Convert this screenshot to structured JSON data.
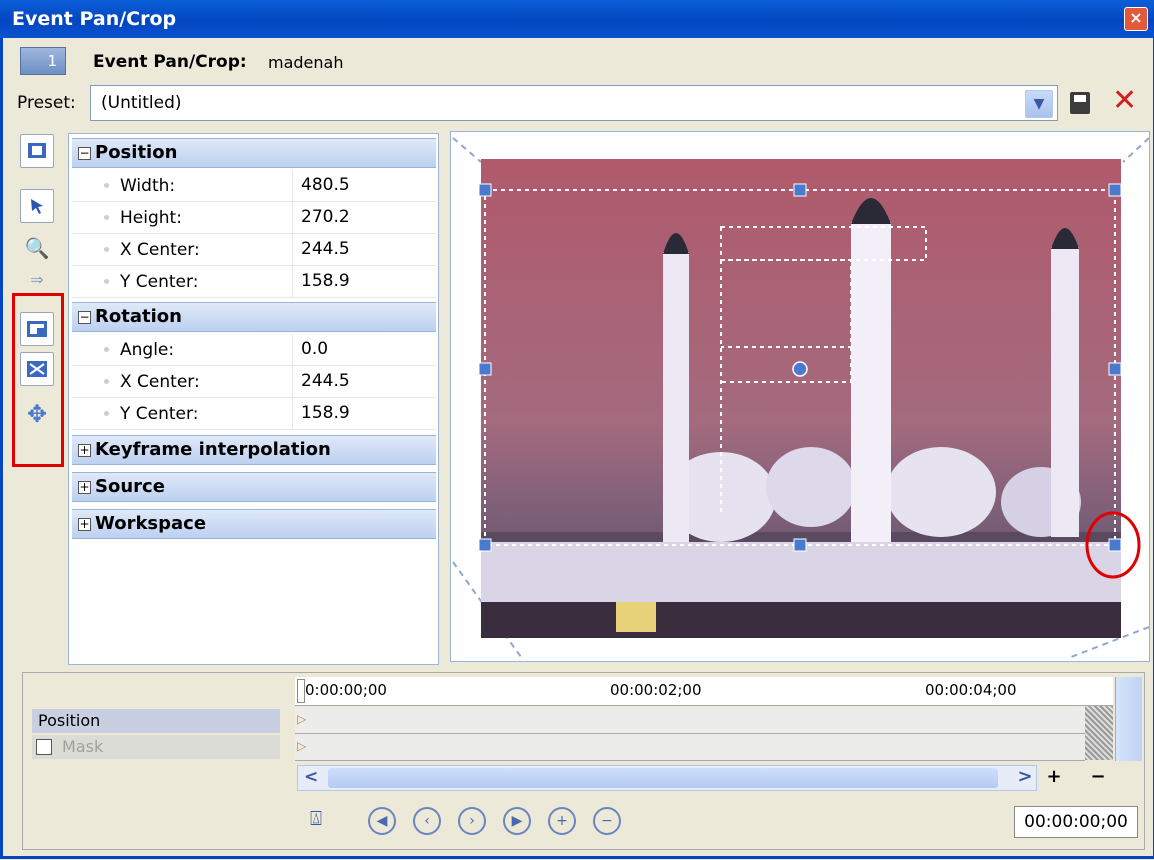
{
  "window": {
    "title": "Event Pan/Crop",
    "close": "×"
  },
  "header": {
    "number": "1",
    "title_label": "Event Pan/Crop:",
    "event_name": "madenah"
  },
  "preset": {
    "label": "Preset:",
    "value": "(Untitled)"
  },
  "properties": {
    "position": {
      "title": "Position",
      "rows": [
        {
          "label": "Width:",
          "value": "480.5"
        },
        {
          "label": "Height:",
          "value": "270.2"
        },
        {
          "label": "X Center:",
          "value": "244.5"
        },
        {
          "label": "Y Center:",
          "value": "158.9"
        }
      ]
    },
    "rotation": {
      "title": "Rotation",
      "rows": [
        {
          "label": "Angle:",
          "value": "0.0"
        },
        {
          "label": "X Center:",
          "value": "244.5"
        },
        {
          "label": "Y Center:",
          "value": "158.9"
        }
      ]
    },
    "keyframe": {
      "title": "Keyframe interpolation"
    },
    "source": {
      "title": "Source"
    },
    "workspace": {
      "title": "Workspace"
    }
  },
  "timeline": {
    "tracks": [
      {
        "label": "Position"
      },
      {
        "label": "Mask"
      }
    ],
    "ticks": [
      "0:00:00;00",
      "00:00:02;00",
      "00:00:04;00"
    ],
    "timecode": "00:00:00;00"
  },
  "colors": {
    "accent": "#0346c0",
    "highlight": "#e00000",
    "section": "#bcd0ef"
  }
}
